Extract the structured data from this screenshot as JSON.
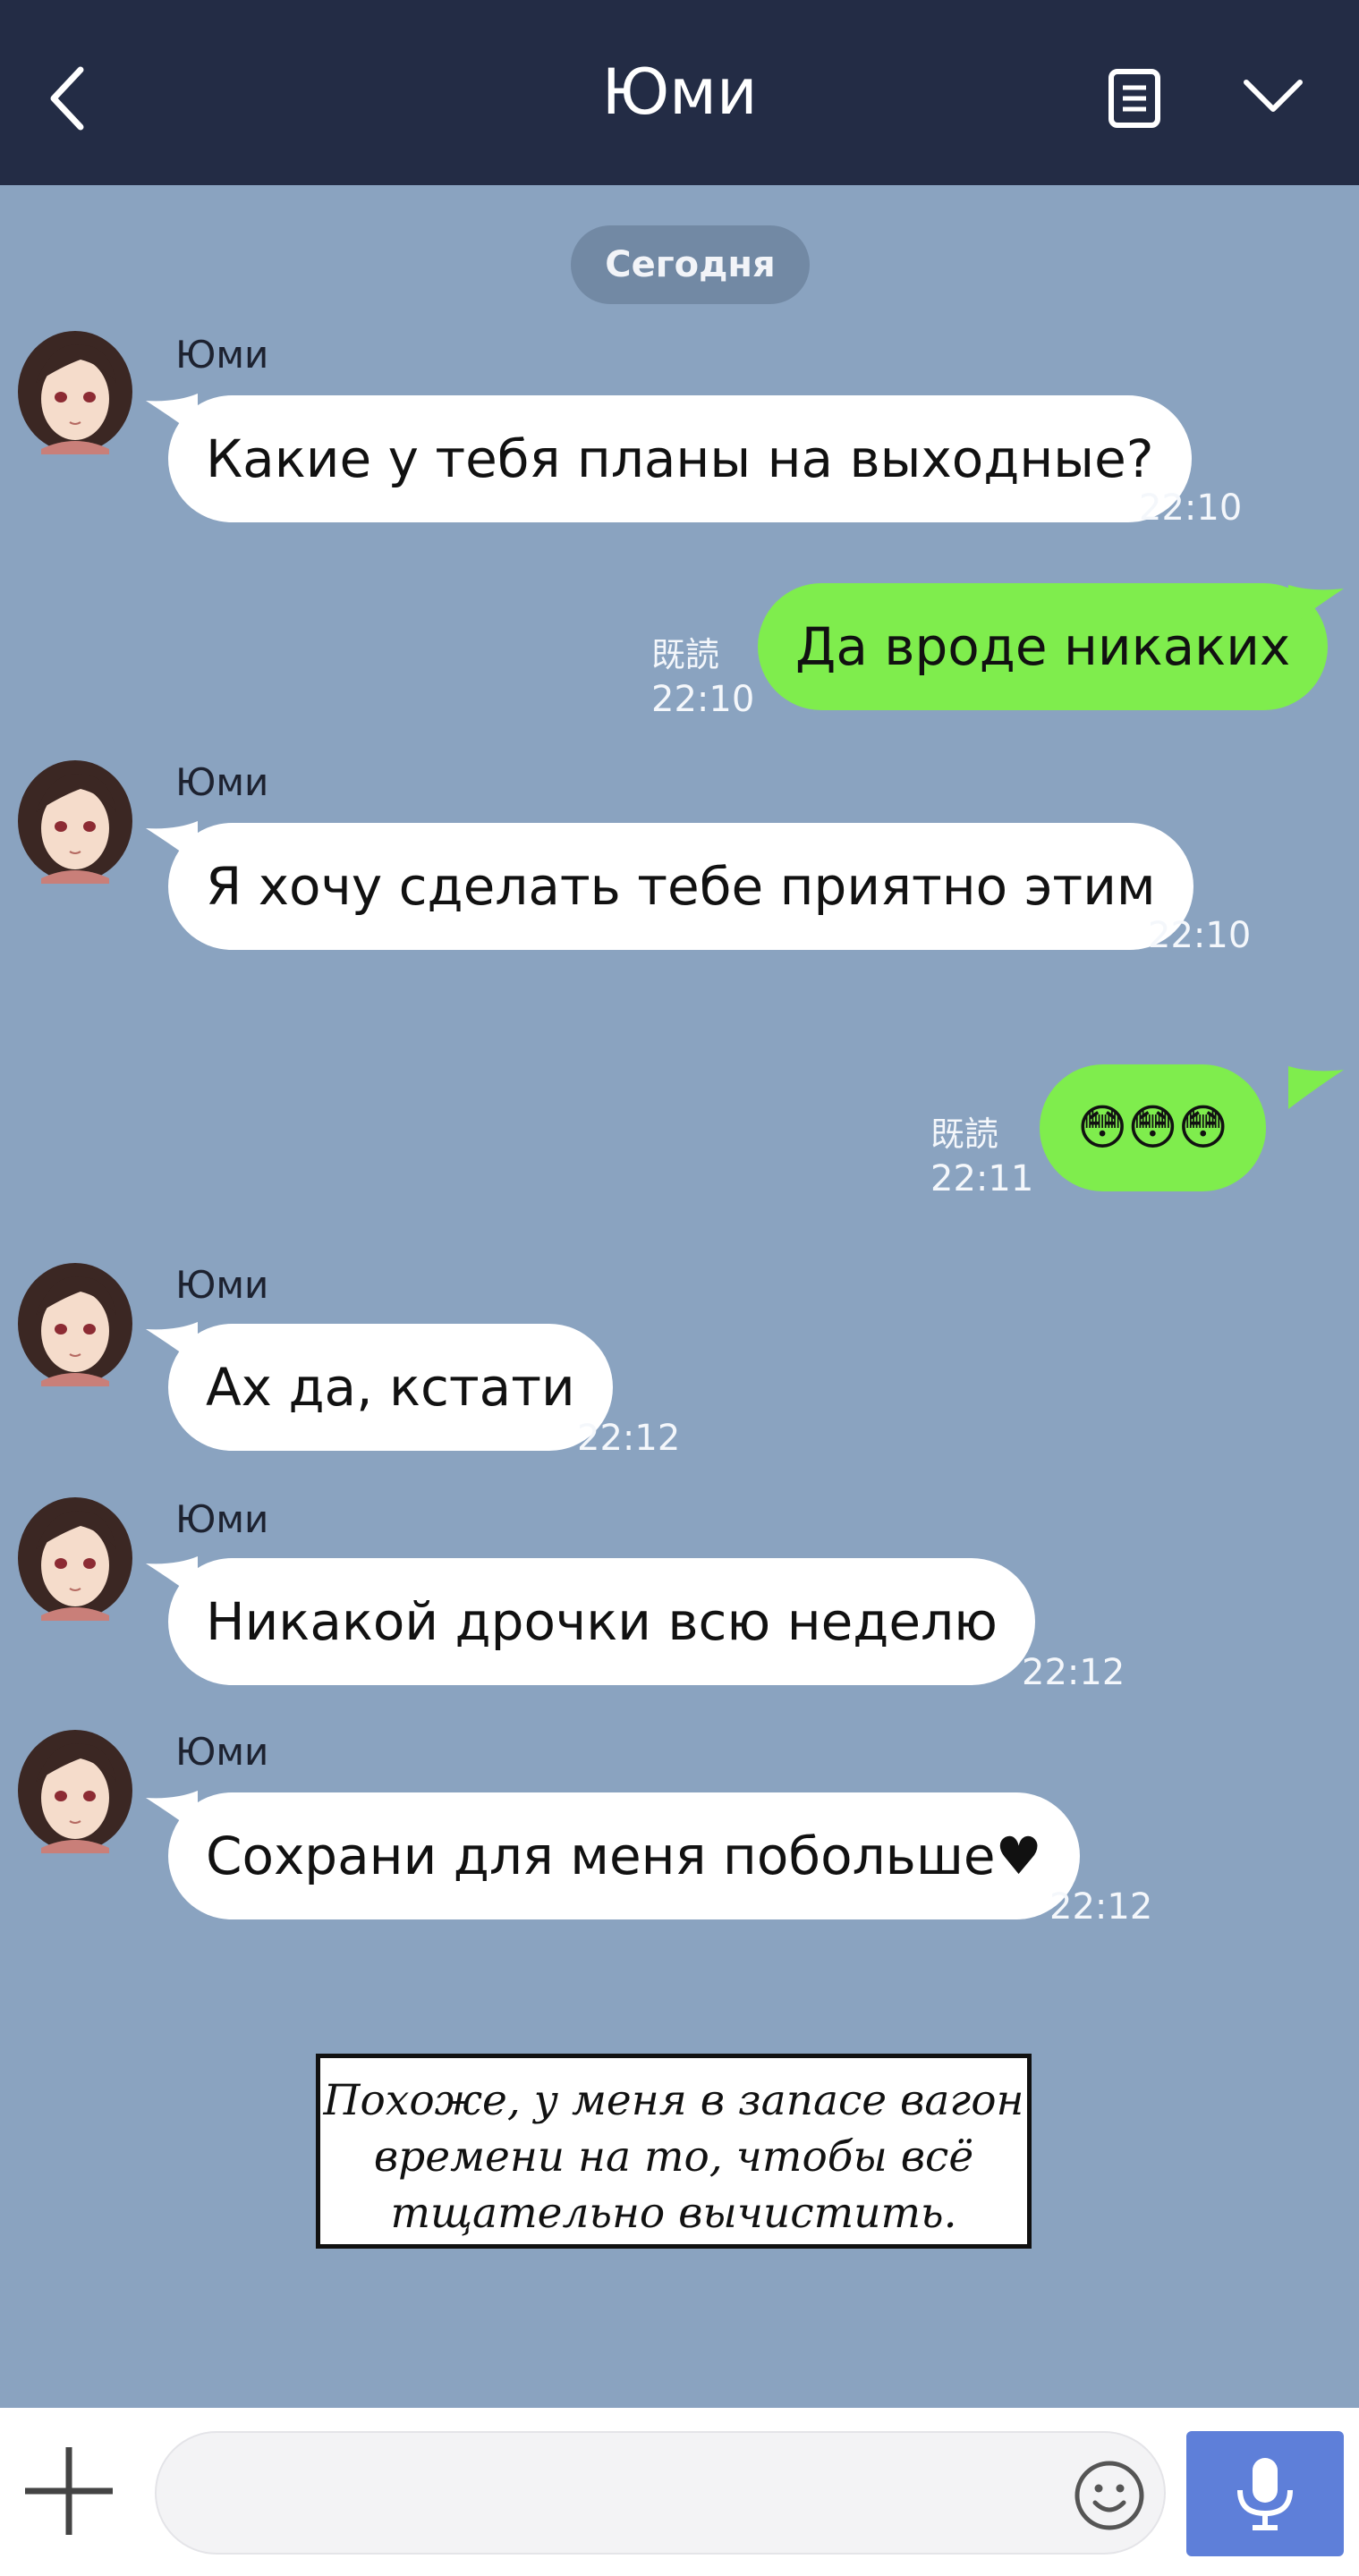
{
  "header": {
    "title": "Юми"
  },
  "date_divider": "Сегодня",
  "messages": [
    {
      "sender": "Юми",
      "text": "Какие у тебя планы на выходные?",
      "time": "22:10"
    },
    {
      "read": "既読",
      "text": "Да вроде никаких",
      "time": "22:10"
    },
    {
      "sender": "Юми",
      "text": "Я хочу сделать тебе приятно этим",
      "time": "22:10"
    },
    {
      "read": "既読",
      "text": "😳😳😳",
      "time": "22:11"
    },
    {
      "sender": "Юми",
      "text": "Ах да, кстати",
      "time": "22:12"
    },
    {
      "sender": "Юми",
      "text": "Никакой дрочки всю неделю",
      "time": "22:12"
    },
    {
      "sender": "Юми",
      "text": "Сохрани для меня побольше♥",
      "time": "22:12"
    }
  ],
  "caption_lines": [
    "Похоже, у меня в запасе вагон",
    "времени на то, чтобы всё",
    "тщательно вычистить."
  ],
  "icons": {
    "back": "chevron-left-icon",
    "notes": "notes-icon",
    "menu": "chevron-down-icon",
    "add": "plus-icon",
    "emoji": "smiley-icon",
    "mic": "microphone-icon"
  },
  "colors": {
    "header_bg": "#232c45",
    "chat_bg": "#8aa3c0",
    "outgoing_bubble": "#7fed4d",
    "incoming_bubble": "#ffffff",
    "mic_button": "#5e7fd9"
  }
}
